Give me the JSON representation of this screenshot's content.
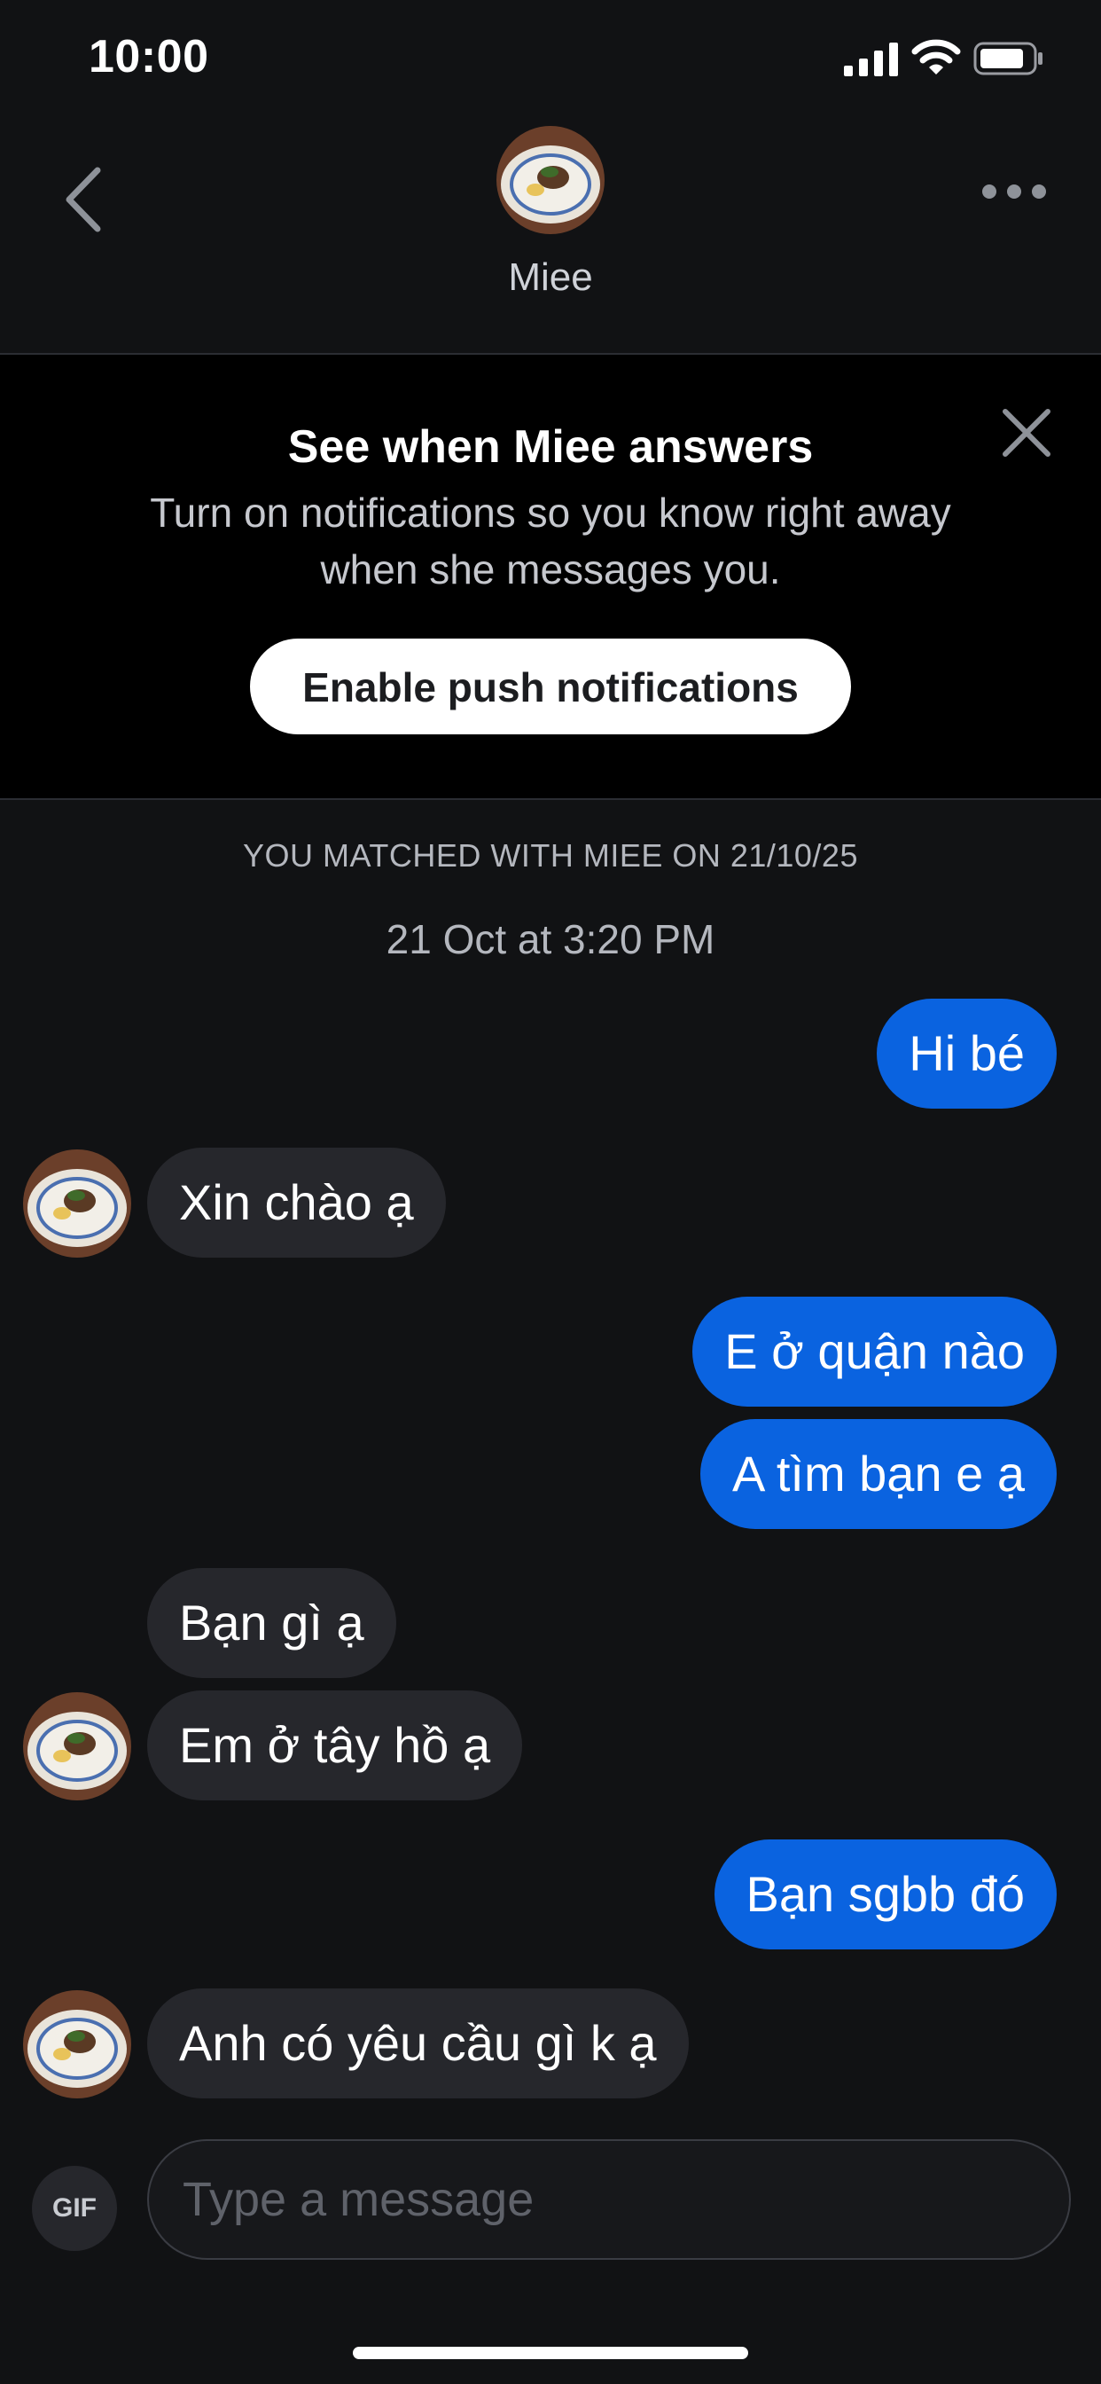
{
  "status_bar": {
    "time": "10:00",
    "icons": [
      "signal-icon",
      "wifi-icon",
      "battery-icon"
    ]
  },
  "header": {
    "contact_name": "Miee",
    "back_icon": "chevron-left-icon",
    "more_icon": "more-horizontal-icon"
  },
  "banner": {
    "title": "See when Miee answers",
    "body": "Turn on notifications so you know right away when she messages you.",
    "button_label": "Enable push notifications",
    "close_icon": "close-icon"
  },
  "chat": {
    "match_text": "YOU MATCHED WITH MIEE ON 21/10/25",
    "timestamp": "21 Oct at 3:20 PM",
    "messages": [
      {
        "from": "me",
        "text": "Hi bé"
      },
      {
        "from": "them",
        "text": "Xin chào ạ"
      },
      {
        "from": "me",
        "text": "E ở quận nào"
      },
      {
        "from": "me",
        "text": "A tìm bạn e ạ"
      },
      {
        "from": "them",
        "text": "Bạn gì ạ"
      },
      {
        "from": "them",
        "text": "Em ở tây hồ ạ"
      },
      {
        "from": "me",
        "text": "Bạn sgbb đó"
      },
      {
        "from": "them",
        "text": "Anh có yêu cầu gì k ạ"
      }
    ]
  },
  "composer": {
    "gif_label": "GIF",
    "placeholder": "Type a message",
    "value": ""
  },
  "colors": {
    "background": "#111214",
    "sent_bubble": "#0a63e0",
    "received_bubble": "#26272c",
    "banner_background": "#000000"
  }
}
